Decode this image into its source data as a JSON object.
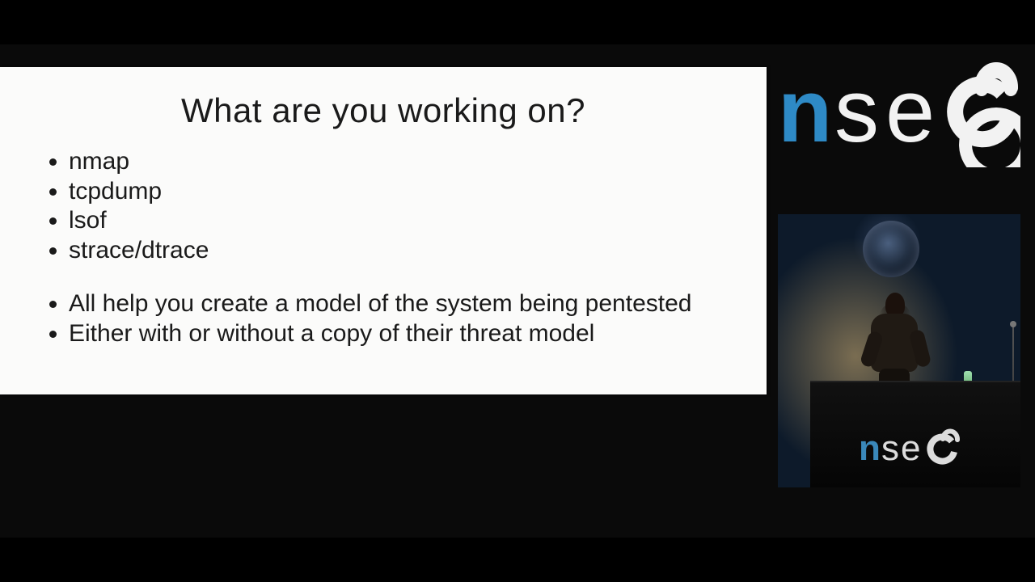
{
  "slide": {
    "title": "What are you working on?",
    "bullets_a": [
      "nmap",
      "tcpdump",
      "lsof",
      "strace/dtrace"
    ],
    "bullets_b": [
      "All help you create a model of the system being pentested",
      "Either with or without a copy of their threat model"
    ]
  },
  "conference": {
    "name": "nsec",
    "logo_colors": {
      "n": "#2e8ac6",
      "text": "#f2f2f2"
    }
  },
  "camera": {
    "description": "Conference speaker standing on stage behind an nsec-branded podium, dim blue backdrop with a circular art piece.",
    "podium_label": "nsec"
  }
}
